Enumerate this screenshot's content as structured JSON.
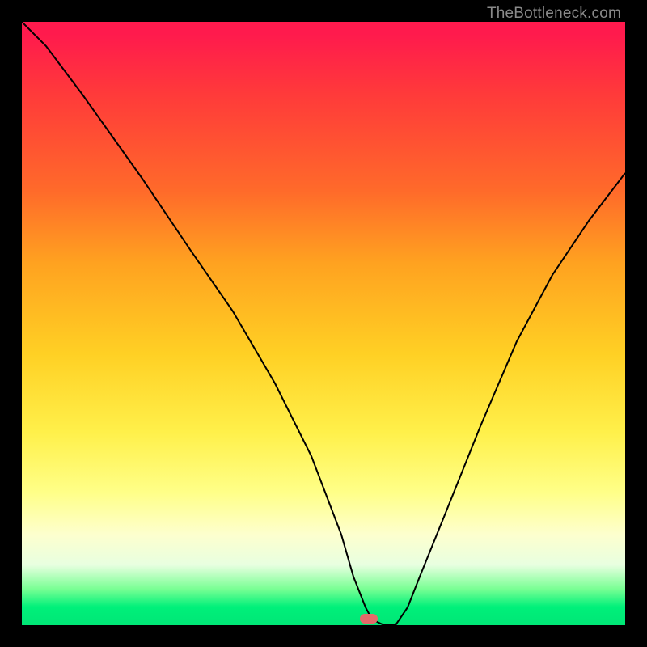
{
  "watermark": "TheBottleneck.com",
  "chart_data": {
    "type": "line",
    "title": "",
    "xlabel": "",
    "ylabel": "",
    "xlim": [
      0,
      100
    ],
    "ylim": [
      0,
      100
    ],
    "grid": false,
    "x": [
      0,
      4,
      10,
      20,
      28,
      35,
      42,
      48,
      53,
      55,
      57,
      58,
      60,
      62,
      64,
      66,
      70,
      76,
      82,
      88,
      94,
      100
    ],
    "y": [
      100,
      96,
      88,
      74,
      62,
      52,
      40,
      28,
      15,
      8,
      3,
      1,
      0,
      0,
      3,
      8,
      18,
      33,
      47,
      58,
      67,
      75
    ],
    "marker": {
      "x": 59,
      "y": 0,
      "color": "#e46a6a"
    },
    "background": "vertical-gradient red→orange→yellow→green"
  }
}
